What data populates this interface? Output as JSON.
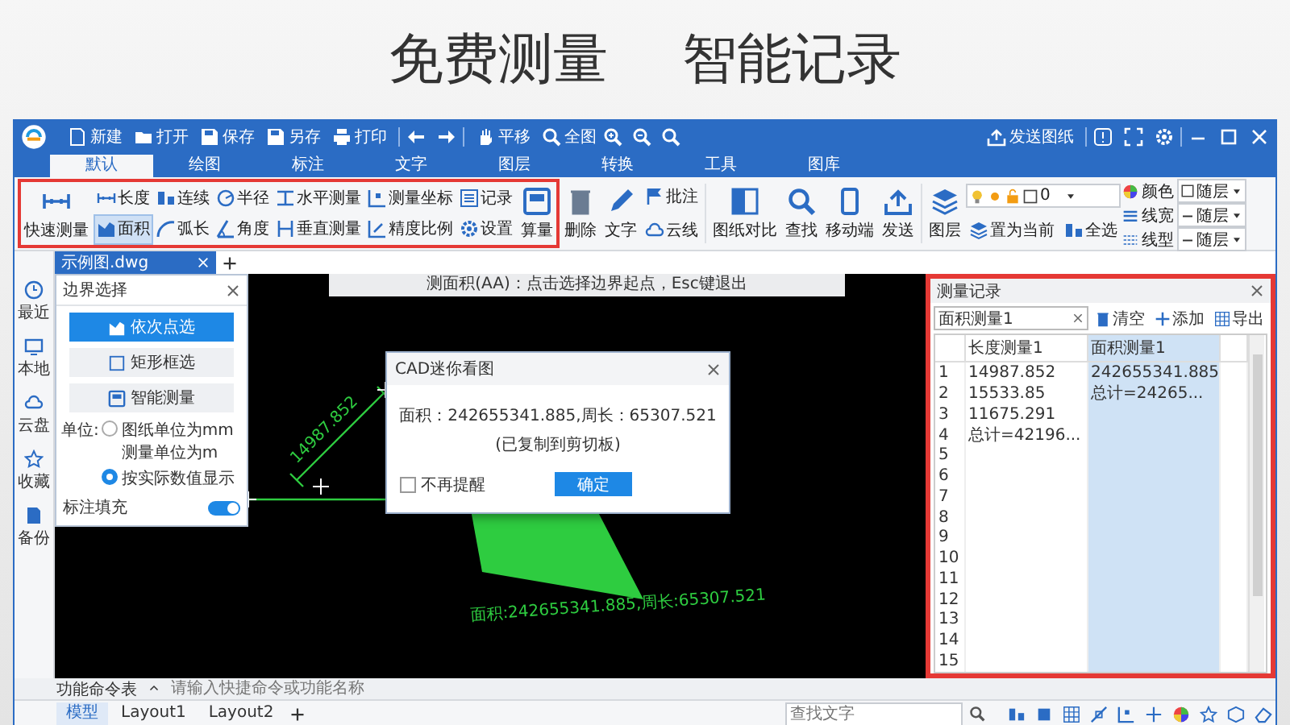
{
  "headline": [
    "免费测量",
    "智能记录"
  ],
  "app": {
    "quick_actions": [
      "新建",
      "打开",
      "保存",
      "另存",
      "打印"
    ],
    "view_actions": [
      "平移",
      "全图"
    ],
    "send_drawing": "发送图纸",
    "tabs": [
      {
        "label": "默认",
        "selected": true
      },
      {
        "label": "绘图",
        "selected": false
      },
      {
        "label": "标注",
        "selected": false
      },
      {
        "label": "文字",
        "selected": false
      },
      {
        "label": "图层",
        "selected": false
      },
      {
        "label": "转换",
        "selected": false
      },
      {
        "label": "工具",
        "selected": false
      },
      {
        "label": "图库",
        "selected": false
      }
    ],
    "ribbon": {
      "measure_highlighted": true,
      "quick_measure": "快速测量",
      "measure_tools": [
        {
          "label": "长度",
          "selected": false
        },
        {
          "label": "连续",
          "selected": false
        },
        {
          "label": "半径",
          "selected": false
        },
        {
          "label": "水平测量",
          "selected": false
        },
        {
          "label": "测量坐标",
          "selected": false
        },
        {
          "label": "记录",
          "selected": false
        },
        {
          "label": "面积",
          "selected": true
        },
        {
          "label": "弧长",
          "selected": false
        },
        {
          "label": "角度",
          "selected": false
        },
        {
          "label": "垂直测量",
          "selected": false
        },
        {
          "label": "精度比例",
          "selected": false
        },
        {
          "label": "设置",
          "selected": false
        }
      ],
      "calculate": "算量",
      "edit_tools": [
        "删除",
        "文字"
      ],
      "annotate_tools": [
        "批注",
        "云线"
      ],
      "view_tools": [
        "图纸对比",
        "查找",
        "移动端",
        "发送"
      ],
      "layer": {
        "label": "图层",
        "current": "0",
        "set_current": "置为当前",
        "select_all": "全选"
      },
      "properties": [
        {
          "label": "颜色",
          "value": "随层"
        },
        {
          "label": "线宽",
          "value": "随层"
        },
        {
          "label": "线型",
          "value": "随层"
        }
      ]
    },
    "document_tab": "示例图.dwg",
    "sidebar": [
      "最近",
      "本地",
      "云盘",
      "收藏",
      "备份"
    ],
    "command_hint": "测面积(AA)：点击选择边界起点，Esc键退出",
    "boundary_panel": {
      "title": "边界选择",
      "modes": [
        {
          "label": "依次点选",
          "selected": true
        },
        {
          "label": "矩形框选",
          "selected": false
        },
        {
          "label": "智能测量",
          "selected": false
        }
      ],
      "unit_label": "单位:",
      "units": [
        {
          "label": "图纸单位为mm 测量单位为m",
          "selected": false
        },
        {
          "label": "按实际数值显示",
          "selected": true
        }
      ],
      "fill_label": "标注填充",
      "fill_on": true
    },
    "canvas": {
      "labels": [
        "14987.852",
        "面积:242655341.885,周长:65307.521"
      ]
    },
    "dialog": {
      "title": "CAD迷你看图",
      "message": "面积：242655341.885,周长：65307.521",
      "note": "(已复制到剪切板)",
      "dont_remind": {
        "label": "不再提醒",
        "checked": false
      },
      "confirm": "确定"
    },
    "records": {
      "highlighted": true,
      "title": "测量记录",
      "name": "面积测量1",
      "actions": [
        "清空",
        "添加",
        "导出"
      ],
      "columns": [
        {
          "label": "长度测量1",
          "selected": false
        },
        {
          "label": "面积测量1",
          "selected": true
        }
      ],
      "rows": [
        {
          "index": "1",
          "values": [
            "14987.852",
            "242655341.885"
          ]
        },
        {
          "index": "2",
          "values": [
            "15533.85",
            "总计=24265..."
          ]
        },
        {
          "index": "3",
          "values": [
            "11675.291"
          ]
        },
        {
          "index": "4",
          "values": [
            "总计=42196..."
          ]
        },
        {
          "index": "5"
        },
        {
          "index": "6"
        },
        {
          "index": "7"
        },
        {
          "index": "8"
        },
        {
          "index": "9"
        },
        {
          "index": "10"
        },
        {
          "index": "11"
        },
        {
          "index": "12"
        },
        {
          "index": "13"
        },
        {
          "index": "14"
        },
        {
          "index": "15"
        }
      ]
    },
    "command_bar": {
      "label": "功能命令表",
      "placeholder": "请输入快捷命令或功能名称"
    },
    "layout_tabs": [
      {
        "label": "模型",
        "selected": true
      },
      {
        "label": "Layout1",
        "selected": false
      },
      {
        "label": "Layout2",
        "selected": false
      }
    ],
    "search": {
      "placeholder": "查找文字"
    }
  }
}
